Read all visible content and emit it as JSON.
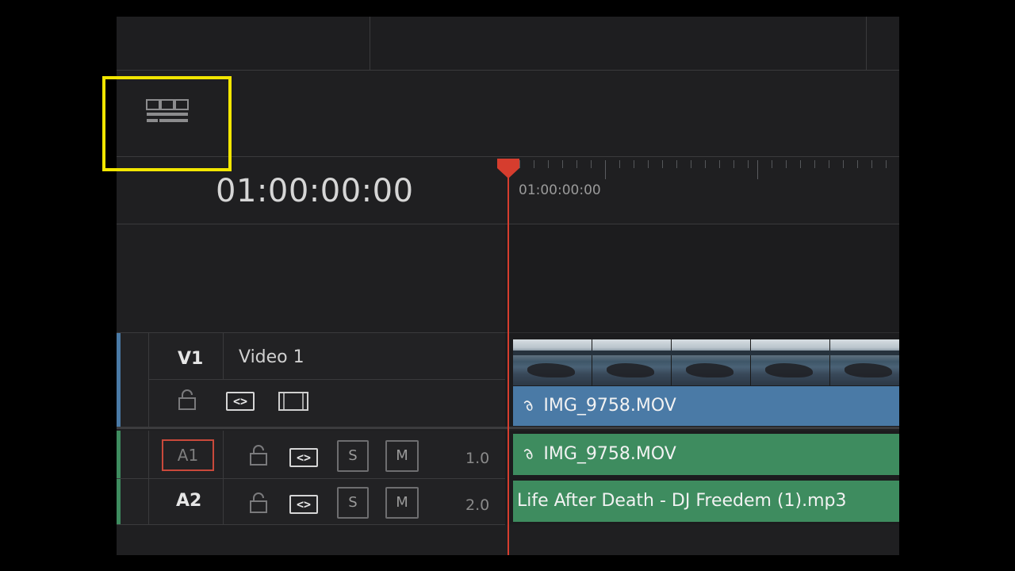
{
  "timeline": {
    "current_timecode": "01:00:00:00",
    "ruler_timecode": "01:00:00:00"
  },
  "tracks": {
    "video": [
      {
        "id": "V1",
        "name": "Video 1",
        "clip": "IMG_9758.MOV"
      }
    ],
    "audio": [
      {
        "id": "A1",
        "level": "1.0",
        "solo": "S",
        "mute": "M",
        "clip": "IMG_9758.MOV"
      },
      {
        "id": "A2",
        "level": "2.0",
        "solo": "S",
        "mute": "M",
        "clip": "Life After Death - DJ Freedem (1).mp3"
      }
    ]
  },
  "icons": {
    "layout": "timeline-layout-icon",
    "lock": "lock-icon",
    "auto_select": "auto-select-icon",
    "video_toggle": "film-icon",
    "clip_link": "link-icon"
  },
  "colors": {
    "playhead": "#d63d2e",
    "video_clip": "#4a7aa6",
    "audio_clip": "#3e8c5f",
    "highlight": "#f2e600",
    "a1_selected_border": "#c9493b"
  }
}
